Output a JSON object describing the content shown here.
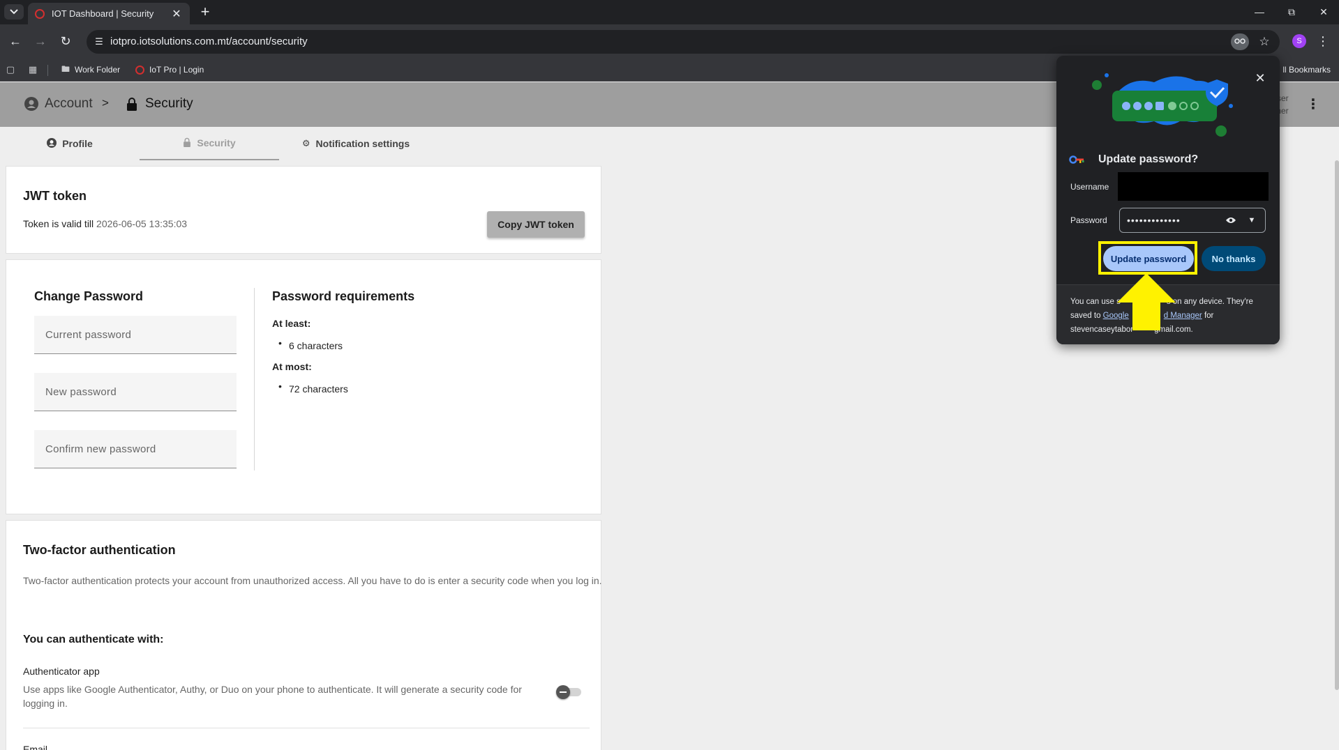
{
  "browser": {
    "tab_title": "IOT Dashboard | Security",
    "tab_close": "✕",
    "new_tab": "+",
    "url": "iotpro.iotsolutions.com.mt/account/security",
    "profile_initial": "S",
    "bookmarks": [
      {
        "label": "Work Folder",
        "icon": "folder-icon"
      },
      {
        "label": "IoT Pro | Login",
        "icon": "red-ring-favicon"
      }
    ],
    "all_bookmarks": "ll Bookmarks"
  },
  "header": {
    "breadcrumb_account": "Account",
    "breadcrumb_sep": ">",
    "breadcrumb_security": "Security",
    "user_line1": "ser",
    "user_line2": "mer"
  },
  "tabs": [
    {
      "label": "Profile",
      "icon": "account-circle-icon"
    },
    {
      "label": "Security",
      "icon": "lock-icon",
      "active": true
    },
    {
      "label": "Notification settings",
      "icon": "gear-icon"
    }
  ],
  "jwt": {
    "title": "JWT token",
    "valid_prefix": "Token is valid till ",
    "valid_date": "2026-06-05 13:35:03",
    "copy_button": "Copy JWT token"
  },
  "change_password": {
    "title": "Change Password",
    "current_placeholder": "Current password",
    "new_placeholder": "New password",
    "confirm_placeholder": "Confirm new password"
  },
  "requirements": {
    "title": "Password requirements",
    "at_least_label": "At least:",
    "at_least_item": "6 characters",
    "at_most_label": "At most:",
    "at_most_item": "72 characters"
  },
  "two_factor": {
    "title": "Two-factor authentication",
    "description": "Two-factor authentication protects your account from unauthorized access. All you have to do is enter a security code when you log in.",
    "subtitle": "You can authenticate with:",
    "authenticator_title": "Authenticator app",
    "authenticator_desc": "Use apps like Google Authenticator, Authy, or Duo on your phone to authenticate. It will generate a security code for logging in.",
    "authenticator_enabled": false,
    "email_label": "Email"
  },
  "password_popup": {
    "title": "Update password?",
    "username_label": "Username",
    "password_label": "Password",
    "password_mask": "•••••••••••••",
    "update_button": "Update password",
    "no_thanks_button": "No thanks",
    "footer_1": "You can use s",
    "footer_2": "s on any device. They're",
    "footer_3": "saved to ",
    "footer_link_1": "Google",
    "footer_link_2": "d Manager",
    "footer_4": " for",
    "footer_5": "stevencaseytabor",
    "footer_6": "gmail.com."
  },
  "colors": {
    "header_bg": "#9e9e9e",
    "page_bg": "#eeeeee",
    "highlight": "#fff200",
    "popup_bg": "#202124"
  }
}
